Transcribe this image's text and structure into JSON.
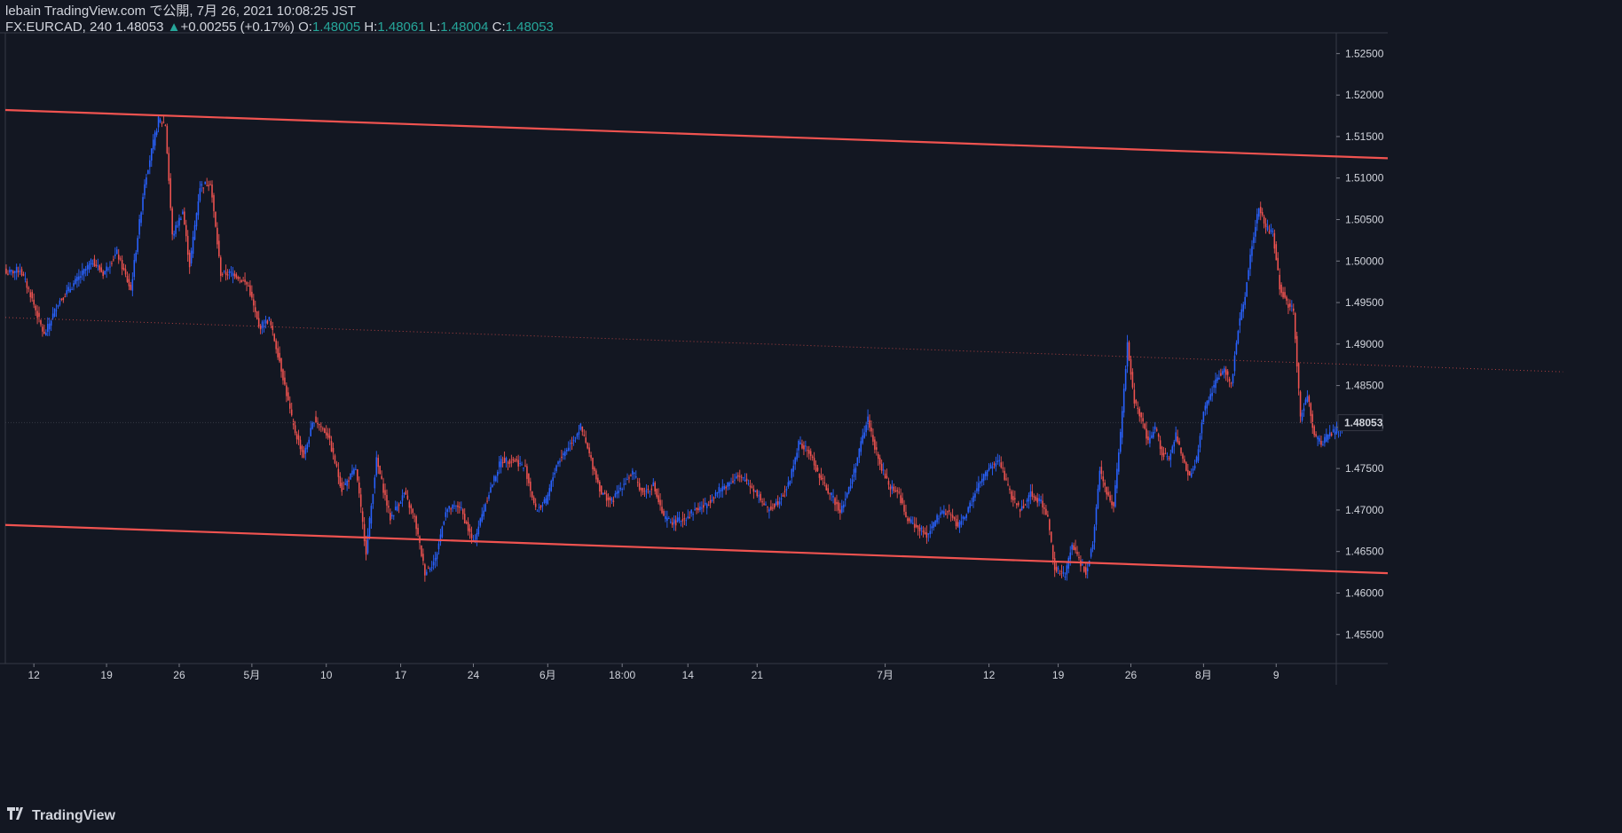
{
  "header": {
    "line1": "lebain TradingView.com で公開, 7月 26, 2021 10:08:25 JST",
    "symbol": "FX:EURCAD, 240",
    "last": "1.48053",
    "change": "+0.00255 (+0.17%)",
    "o_label": "O:",
    "o": "1.48005",
    "h_label": "H:",
    "h": "1.48061",
    "l_label": "L:",
    "l": "1.48004",
    "c_label": "C:",
    "c": "1.48053"
  },
  "footer": {
    "brand": "TradingView",
    "logo_icon": "tradingview-logo-icon"
  },
  "colors": {
    "background": "#131722",
    "up": "#2962ff",
    "down": "#ef5350",
    "channel": "#f05350",
    "text": "#d1d4dc",
    "accent": "#26a69a"
  },
  "chart_data": {
    "type": "candlestick",
    "interval": "240",
    "x_tick_labels": [
      "12",
      "19",
      "26",
      "5月",
      "10",
      "17",
      "24",
      "6月",
      "18:00",
      "14",
      "21",
      "7月",
      "12",
      "19",
      "26",
      "8月",
      "9"
    ],
    "y_tick_labels": [
      "1.52500",
      "1.52000",
      "1.51500",
      "1.51000",
      "1.50500",
      "1.50000",
      "1.49500",
      "1.49000",
      "1.48500",
      "1.48000",
      "1.47500",
      "1.47000",
      "1.46500",
      "1.46000",
      "1.45500"
    ],
    "ylim": [
      1.4515,
      1.5275
    ],
    "current_price_label": "1.48053",
    "close_path": [
      {
        "bar": 0,
        "close": 1.4985
      },
      {
        "bar": 8,
        "close": 1.499
      },
      {
        "bar": 14,
        "close": 1.496
      },
      {
        "bar": 22,
        "close": 1.491
      },
      {
        "bar": 30,
        "close": 1.495
      },
      {
        "bar": 40,
        "close": 1.4975
      },
      {
        "bar": 50,
        "close": 1.5
      },
      {
        "bar": 56,
        "close": 1.4985
      },
      {
        "bar": 64,
        "close": 1.501
      },
      {
        "bar": 72,
        "close": 1.4965
      },
      {
        "bar": 80,
        "close": 1.5095
      },
      {
        "bar": 88,
        "close": 1.517
      },
      {
        "bar": 92,
        "close": 1.5165
      },
      {
        "bar": 96,
        "close": 1.503
      },
      {
        "bar": 102,
        "close": 1.506
      },
      {
        "bar": 106,
        "close": 1.4995
      },
      {
        "bar": 112,
        "close": 1.509
      },
      {
        "bar": 118,
        "close": 1.5095
      },
      {
        "bar": 124,
        "close": 1.4985
      },
      {
        "bar": 132,
        "close": 1.4985
      },
      {
        "bar": 140,
        "close": 1.497
      },
      {
        "bar": 146,
        "close": 1.492
      },
      {
        "bar": 152,
        "close": 1.493
      },
      {
        "bar": 158,
        "close": 1.488
      },
      {
        "bar": 166,
        "close": 1.48
      },
      {
        "bar": 172,
        "close": 1.4765
      },
      {
        "bar": 178,
        "close": 1.481
      },
      {
        "bar": 186,
        "close": 1.479
      },
      {
        "bar": 194,
        "close": 1.4725
      },
      {
        "bar": 202,
        "close": 1.475
      },
      {
        "bar": 208,
        "close": 1.465
      },
      {
        "bar": 214,
        "close": 1.476
      },
      {
        "bar": 222,
        "close": 1.469
      },
      {
        "bar": 230,
        "close": 1.472
      },
      {
        "bar": 236,
        "close": 1.469
      },
      {
        "bar": 242,
        "close": 1.4625
      },
      {
        "bar": 248,
        "close": 1.464
      },
      {
        "bar": 254,
        "close": 1.47
      },
      {
        "bar": 262,
        "close": 1.4705
      },
      {
        "bar": 270,
        "close": 1.466
      },
      {
        "bar": 278,
        "close": 1.4715
      },
      {
        "bar": 286,
        "close": 1.476
      },
      {
        "bar": 294,
        "close": 1.476
      },
      {
        "bar": 300,
        "close": 1.475
      },
      {
        "bar": 306,
        "close": 1.47
      },
      {
        "bar": 312,
        "close": 1.471
      },
      {
        "bar": 318,
        "close": 1.4755
      },
      {
        "bar": 326,
        "close": 1.478
      },
      {
        "bar": 332,
        "close": 1.48
      },
      {
        "bar": 338,
        "close": 1.476
      },
      {
        "bar": 344,
        "close": 1.472
      },
      {
        "bar": 350,
        "close": 1.471
      },
      {
        "bar": 356,
        "close": 1.473
      },
      {
        "bar": 362,
        "close": 1.4745
      },
      {
        "bar": 368,
        "close": 1.472
      },
      {
        "bar": 374,
        "close": 1.473
      },
      {
        "bar": 380,
        "close": 1.469
      },
      {
        "bar": 386,
        "close": 1.4685
      },
      {
        "bar": 392,
        "close": 1.469
      },
      {
        "bar": 398,
        "close": 1.47
      },
      {
        "bar": 404,
        "close": 1.4705
      },
      {
        "bar": 410,
        "close": 1.472
      },
      {
        "bar": 416,
        "close": 1.473
      },
      {
        "bar": 422,
        "close": 1.474
      },
      {
        "bar": 428,
        "close": 1.4735
      },
      {
        "bar": 434,
        "close": 1.472
      },
      {
        "bar": 440,
        "close": 1.47
      },
      {
        "bar": 446,
        "close": 1.471
      },
      {
        "bar": 452,
        "close": 1.473
      },
      {
        "bar": 458,
        "close": 1.478
      },
      {
        "bar": 464,
        "close": 1.477
      },
      {
        "bar": 470,
        "close": 1.474
      },
      {
        "bar": 476,
        "close": 1.472
      },
      {
        "bar": 482,
        "close": 1.47
      },
      {
        "bar": 488,
        "close": 1.473
      },
      {
        "bar": 494,
        "close": 1.478
      },
      {
        "bar": 498,
        "close": 1.481
      },
      {
        "bar": 504,
        "close": 1.476
      },
      {
        "bar": 510,
        "close": 1.473
      },
      {
        "bar": 516,
        "close": 1.472
      },
      {
        "bar": 520,
        "close": 1.469
      },
      {
        "bar": 526,
        "close": 1.468
      },
      {
        "bar": 532,
        "close": 1.467
      },
      {
        "bar": 538,
        "close": 1.469
      },
      {
        "bar": 544,
        "close": 1.47
      },
      {
        "bar": 550,
        "close": 1.468
      },
      {
        "bar": 556,
        "close": 1.47
      },
      {
        "bar": 562,
        "close": 1.473
      },
      {
        "bar": 568,
        "close": 1.475
      },
      {
        "bar": 574,
        "close": 1.476
      },
      {
        "bar": 580,
        "close": 1.472
      },
      {
        "bar": 586,
        "close": 1.47
      },
      {
        "bar": 592,
        "close": 1.472
      },
      {
        "bar": 598,
        "close": 1.471
      },
      {
        "bar": 602,
        "close": 1.469
      },
      {
        "bar": 606,
        "close": 1.463
      },
      {
        "bar": 612,
        "close": 1.462
      },
      {
        "bar": 616,
        "close": 1.466
      },
      {
        "bar": 620,
        "close": 1.464
      },
      {
        "bar": 624,
        "close": 1.4625
      },
      {
        "bar": 628,
        "close": 1.466
      },
      {
        "bar": 632,
        "close": 1.475
      },
      {
        "bar": 636,
        "close": 1.472
      },
      {
        "bar": 640,
        "close": 1.4705
      },
      {
        "bar": 644,
        "close": 1.479
      },
      {
        "bar": 648,
        "close": 1.49
      },
      {
        "bar": 652,
        "close": 1.483
      },
      {
        "bar": 656,
        "close": 1.481
      },
      {
        "bar": 660,
        "close": 1.478
      },
      {
        "bar": 664,
        "close": 1.48
      },
      {
        "bar": 668,
        "close": 1.477
      },
      {
        "bar": 672,
        "close": 1.476
      },
      {
        "bar": 676,
        "close": 1.479
      },
      {
        "bar": 680,
        "close": 1.476
      },
      {
        "bar": 684,
        "close": 1.474
      },
      {
        "bar": 688,
        "close": 1.476
      },
      {
        "bar": 692,
        "close": 1.482
      },
      {
        "bar": 696,
        "close": 1.484
      },
      {
        "bar": 700,
        "close": 1.486
      },
      {
        "bar": 704,
        "close": 1.487
      },
      {
        "bar": 708,
        "close": 1.485
      },
      {
        "bar": 712,
        "close": 1.492
      },
      {
        "bar": 716,
        "close": 1.496
      },
      {
        "bar": 720,
        "close": 1.502
      },
      {
        "bar": 724,
        "close": 1.5065
      },
      {
        "bar": 728,
        "close": 1.504
      },
      {
        "bar": 732,
        "close": 1.5035
      },
      {
        "bar": 736,
        "close": 1.497
      },
      {
        "bar": 740,
        "close": 1.495
      },
      {
        "bar": 744,
        "close": 1.494
      },
      {
        "bar": 748,
        "close": 1.481
      },
      {
        "bar": 752,
        "close": 1.484
      },
      {
        "bar": 756,
        "close": 1.479
      },
      {
        "bar": 760,
        "close": 1.478
      },
      {
        "bar": 764,
        "close": 1.479
      },
      {
        "bar": 768,
        "close": 1.4795
      },
      {
        "bar": 772,
        "close": 1.4805
      }
    ],
    "overlays": [
      {
        "name": "channel-upper",
        "points": [
          [
            0,
            1.5182
          ],
          [
            2021,
            1.5035
          ]
        ]
      },
      {
        "name": "channel-lower",
        "points": [
          [
            0,
            1.4682
          ],
          [
            2021,
            1.4535
          ]
        ]
      },
      {
        "name": "channel-mid",
        "style": "dotted",
        "points": [
          [
            0,
            1.4932
          ],
          [
            2021,
            1.4785
          ]
        ]
      }
    ]
  }
}
